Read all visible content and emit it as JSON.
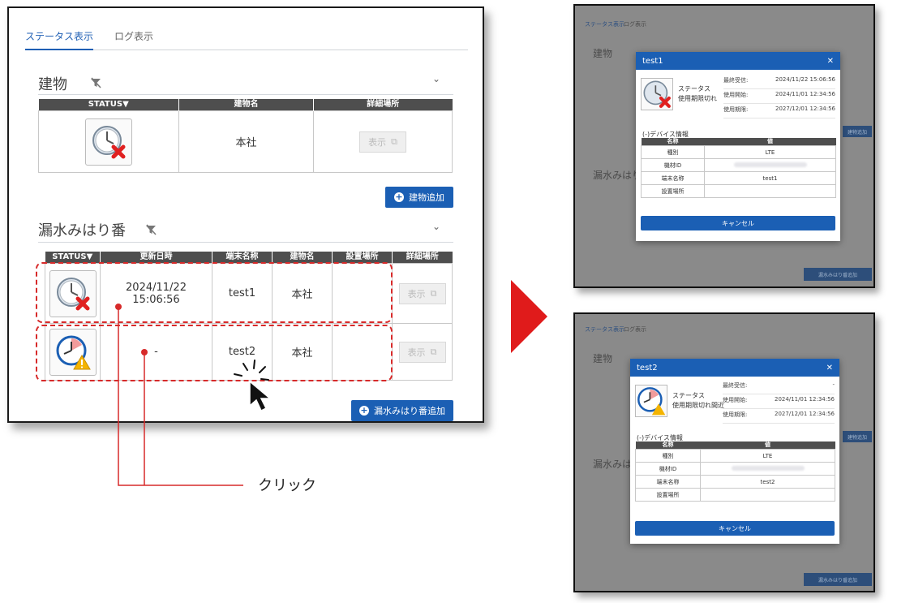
{
  "tabs": [
    "ステータス表示",
    "ログ表示"
  ],
  "building": {
    "title": "建物",
    "columns": [
      "STATUS▼",
      "建物名",
      "詳細場所"
    ],
    "row": {
      "name": "本社",
      "detail_button": "表示"
    },
    "add_button": "建物追加"
  },
  "leak": {
    "title": "漏水みはり番",
    "columns": [
      "STATUS▼",
      "更新日時",
      "端末名称",
      "建物名",
      "設置場所",
      "詳細場所"
    ],
    "rows": [
      {
        "updated": "2024/11/22 15:06:56",
        "terminal": "test1",
        "building": "本社",
        "location": "",
        "detail_button": "表示"
      },
      {
        "updated": "-",
        "terminal": "test2",
        "building": "本社",
        "location": "",
        "detail_button": "表示"
      }
    ],
    "add_button": "漏水みはり番追加"
  },
  "callout": {
    "label": "クリック"
  },
  "modal1": {
    "title": "test1",
    "status_label": "ステータス",
    "status_value": "使用期限切れ",
    "info": [
      {
        "label": "最終受信:",
        "value": "2024/11/22 15:06:56"
      },
      {
        "label": "使用開始:",
        "value": "2024/11/01 12:34:56"
      },
      {
        "label": "使用期限:",
        "value": "2027/12/01 12:34:56"
      }
    ],
    "device_heading": "デバイス情報",
    "columns": [
      "名称",
      "値"
    ],
    "rows": [
      {
        "name": "種別",
        "value": "LTE"
      },
      {
        "name": "機材ID",
        "value": ""
      },
      {
        "name": "端末名称",
        "value": "test1"
      },
      {
        "name": "設置場所",
        "value": ""
      }
    ],
    "cancel": "キャンセル"
  },
  "modal2": {
    "title": "test2",
    "status_label": "ステータス",
    "status_value": "使用期限切れ間近",
    "info": [
      {
        "label": "最終受信:",
        "value": "-"
      },
      {
        "label": "使用開始:",
        "value": "2024/11/01 12:34:56"
      },
      {
        "label": "使用期限:",
        "value": "2027/12/01 12:34:56"
      }
    ],
    "device_heading": "デバイス情報",
    "columns": [
      "名称",
      "値"
    ],
    "rows": [
      {
        "name": "種別",
        "value": "LTE"
      },
      {
        "name": "機材ID",
        "value": ""
      },
      {
        "name": "端末名称",
        "value": "test2"
      },
      {
        "name": "設置場所",
        "value": ""
      }
    ],
    "cancel": "キャンセル"
  },
  "background_snippets": {
    "section_building": "建物",
    "section_leak": "漏水みはり",
    "add_building": "建物追加",
    "add_leak": "漏水みはり番追加"
  },
  "colors": {
    "accent": "#1b5fb4",
    "highlight": "#d72a2a",
    "header": "#4e4e4e"
  }
}
